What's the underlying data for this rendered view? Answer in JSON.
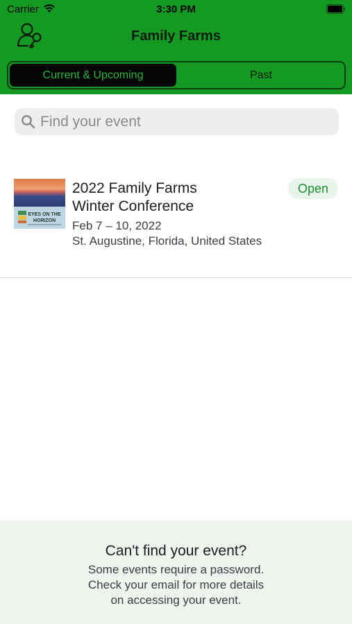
{
  "status_bar": {
    "carrier": "Carrier",
    "time": "3:30 PM"
  },
  "nav": {
    "title": "Family Farms",
    "login_icon": "person-key-icon"
  },
  "segments": [
    {
      "label": "Current & Upcoming",
      "selected": true
    },
    {
      "label": "Past",
      "selected": false
    }
  ],
  "search": {
    "placeholder": "Find your event",
    "value": "",
    "icon": "search-icon"
  },
  "events": [
    {
      "title_line1": "2022 Family Farms",
      "title_line2": "Winter Conference",
      "date": "Feb 7 – 10, 2022",
      "location": "St. Augustine, Florida, United States",
      "status": "Open",
      "thumb_text_1": "EYES ON THE",
      "thumb_text_2": "HORIZON"
    }
  ],
  "footer": {
    "title": "Can't find your event?",
    "line1": "Some events require a password.",
    "line2": "Check your email for more details",
    "line3": "on accessing your event."
  },
  "colors": {
    "header_green": "#149a22",
    "selected_segment": "#050505",
    "open_text": "#1f8f2e",
    "footer_bg": "#edf5ee"
  }
}
